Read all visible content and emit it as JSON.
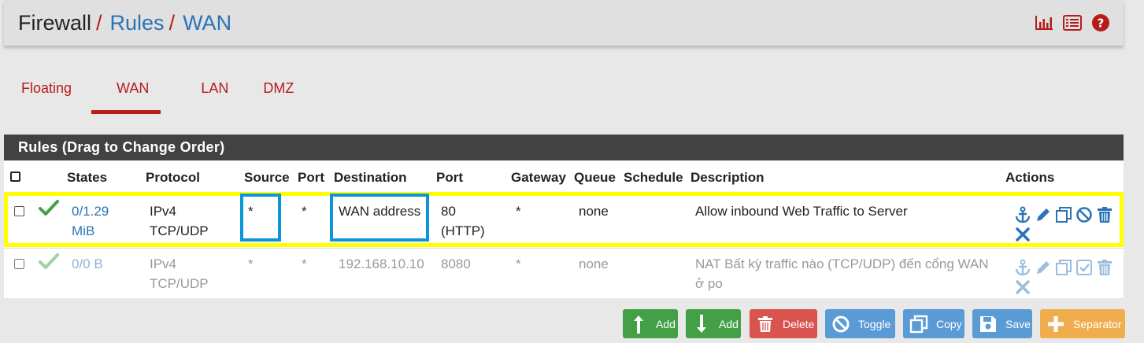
{
  "breadcrumb": {
    "root": "Firewall",
    "sep1": "/",
    "item1": "Rules",
    "sep2": "/",
    "item2": "WAN"
  },
  "header_icons": [
    "bar-chart-icon",
    "list-icon",
    "help-icon"
  ],
  "tabs": [
    {
      "label": "Floating",
      "active": false
    },
    {
      "label": "WAN",
      "active": true
    },
    {
      "label": "LAN",
      "active": false
    },
    {
      "label": "DMZ",
      "active": false
    }
  ],
  "panel": {
    "title": "Rules (Drag to Change Order)"
  },
  "columns": [
    "States",
    "Protocol",
    "Source",
    "Port",
    "Destination",
    "Port",
    "Gateway",
    "Queue",
    "Schedule",
    "Description",
    "Actions"
  ],
  "rows": [
    {
      "enabled": true,
      "states_line1": "0/1.29",
      "states_line2": "MiB",
      "protocol_line1": "IPv4",
      "protocol_line2": "TCP/UDP",
      "source": "*",
      "source_port": "*",
      "destination": "WAN address",
      "dest_port_line1": "80",
      "dest_port_line2": "(HTTP)",
      "gateway": "*",
      "queue": "none",
      "schedule": "",
      "description_line1": "Allow inbound Web Traffic to Server",
      "description_line2": ""
    },
    {
      "enabled": false,
      "states_line1": "0/0 B",
      "states_line2": "",
      "protocol_line1": "IPv4",
      "protocol_line2": "TCP/UDP",
      "source": "*",
      "source_port": "*",
      "destination": "192.168.10.10",
      "dest_port_line1": "8080",
      "dest_port_line2": "",
      "gateway": "*",
      "queue": "none",
      "schedule": "",
      "description_line1": "NAT Bất kỳ traffic nào (TCP/UDP) đến cổng WAN",
      "description_line2": "ở po"
    }
  ],
  "buttons": {
    "add_top": "Add",
    "add_bottom": "Add",
    "delete": "Delete",
    "toggle": "Toggle",
    "copy": "Copy",
    "save": "Save",
    "separator": "Separator"
  },
  "colors": {
    "accent_red": "#b71c1c",
    "link_blue": "#2a73b8",
    "panel_heading": "#424242",
    "highlight_yellow": "#ffff00",
    "highlight_blue": "#0a96d8",
    "btn_green": "#43a047",
    "btn_red": "#d9534f",
    "btn_blue": "#5b9bd5",
    "btn_orange": "#f0ad4e"
  }
}
